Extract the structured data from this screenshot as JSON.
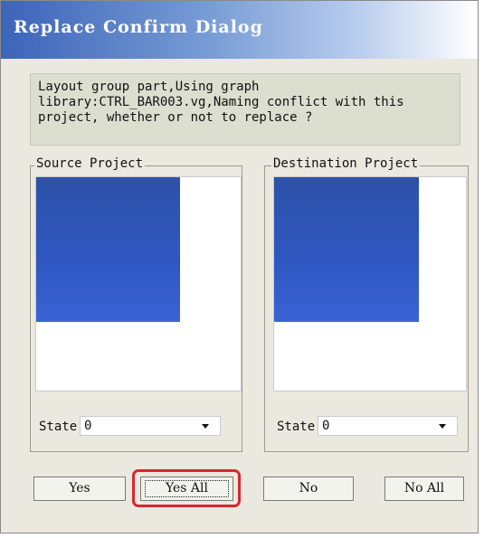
{
  "window": {
    "title": "Replace Confirm Dialog"
  },
  "message": {
    "text": "Layout group part,Using graph\nlibrary:CTRL_BAR003.vg,Naming conflict with this\nproject, whether or not to replace ?"
  },
  "source": {
    "legend": "Source Project",
    "state_label": "State",
    "state_value": "0"
  },
  "destination": {
    "legend": "Destination Project",
    "state_label": "State",
    "state_value": "0"
  },
  "buttons": {
    "yes": "Yes",
    "yes_all": "Yes All",
    "no": "No",
    "no_all": "No All"
  },
  "colors": {
    "preview_blue": "#2f57c2",
    "highlight_red": "#d7262e",
    "title_blue": "#3c64b8"
  }
}
